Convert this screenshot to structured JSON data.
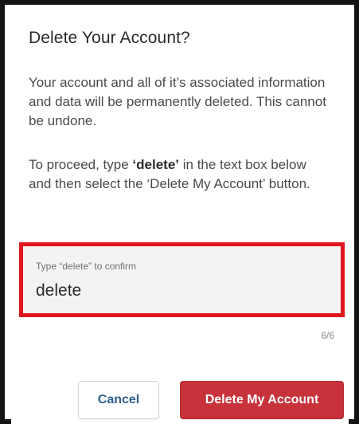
{
  "dialog": {
    "title": "Delete Your Account?",
    "warning_text": "Your account and all of it’s associated information and data will be permanently deleted. This cannot be undone.",
    "instruction_prefix": "To proceed, type ",
    "instruction_keyword": "‘delete’",
    "instruction_suffix": " in the text box below and then select the ‘Delete My Account’ button."
  },
  "confirm_input": {
    "label": "Type “delete” to confirm",
    "value": "delete",
    "counter": "6/6",
    "highlight_color": "#e0161e"
  },
  "buttons": {
    "cancel_label": "Cancel",
    "delete_label": "Delete My Account",
    "delete_color": "#c8323a"
  }
}
